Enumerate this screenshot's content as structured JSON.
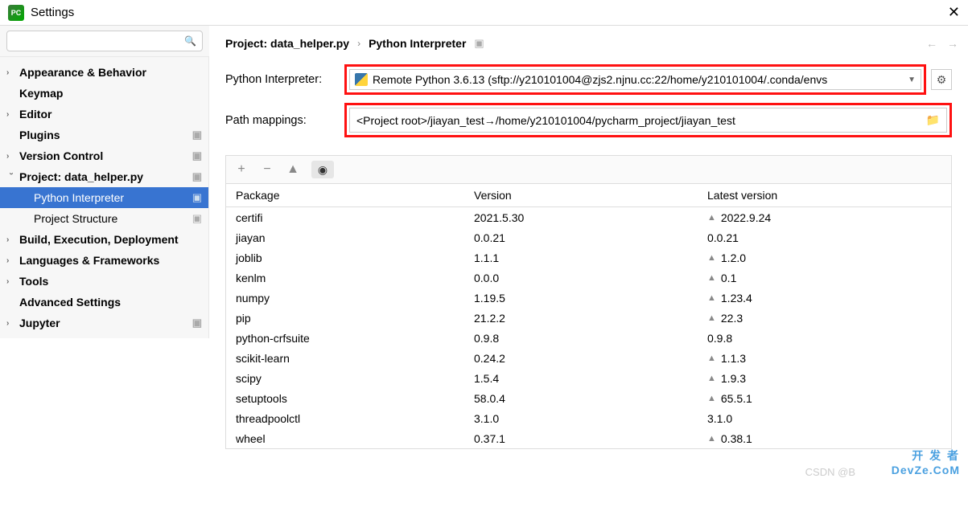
{
  "titlebar": {
    "title": "Settings"
  },
  "search": {
    "placeholder": ""
  },
  "sidebar": {
    "items": [
      {
        "label": "Appearance & Behavior"
      },
      {
        "label": "Keymap"
      },
      {
        "label": "Editor"
      },
      {
        "label": "Plugins"
      },
      {
        "label": "Version Control"
      },
      {
        "label": "Project: data_helper.py"
      },
      {
        "label": "Python Interpreter"
      },
      {
        "label": "Project Structure"
      },
      {
        "label": "Build, Execution, Deployment"
      },
      {
        "label": "Languages & Frameworks"
      },
      {
        "label": "Tools"
      },
      {
        "label": "Advanced Settings"
      },
      {
        "label": "Jupyter"
      }
    ]
  },
  "breadcrumb": {
    "project": "Project: data_helper.py",
    "page": "Python Interpreter"
  },
  "fields": {
    "interpreter_label": "Python Interpreter:",
    "interpreter_value": "Remote Python 3.6.13 (sftp://y210101004@zjs2.njnu.cc:22/home/y210101004/.conda/envs",
    "path_label": "Path mappings:",
    "path_value": "<Project root>/jiayan_test→/home/y210101004/pycharm_project/jiayan_test"
  },
  "table": {
    "headers": {
      "pkg": "Package",
      "ver": "Version",
      "lat": "Latest version"
    },
    "rows": [
      {
        "pkg": "certifi",
        "ver": "2021.5.30",
        "lat": "2022.9.24",
        "up": true
      },
      {
        "pkg": "jiayan",
        "ver": "0.0.21",
        "lat": "0.0.21",
        "up": false
      },
      {
        "pkg": "joblib",
        "ver": "1.1.1",
        "lat": "1.2.0",
        "up": true
      },
      {
        "pkg": "kenlm",
        "ver": "0.0.0",
        "lat": "0.1",
        "up": true
      },
      {
        "pkg": "numpy",
        "ver": "1.19.5",
        "lat": "1.23.4",
        "up": true
      },
      {
        "pkg": "pip",
        "ver": "21.2.2",
        "lat": "22.3",
        "up": true
      },
      {
        "pkg": "python-crfsuite",
        "ver": "0.9.8",
        "lat": "0.9.8",
        "up": false
      },
      {
        "pkg": "scikit-learn",
        "ver": "0.24.2",
        "lat": "1.1.3",
        "up": true
      },
      {
        "pkg": "scipy",
        "ver": "1.5.4",
        "lat": "1.9.3",
        "up": true
      },
      {
        "pkg": "setuptools",
        "ver": "58.0.4",
        "lat": "65.5.1",
        "up": true
      },
      {
        "pkg": "threadpoolctl",
        "ver": "3.1.0",
        "lat": "3.1.0",
        "up": false
      },
      {
        "pkg": "wheel",
        "ver": "0.37.1",
        "lat": "0.38.1",
        "up": true
      }
    ]
  },
  "watermark": {
    "line1": "开 发 者",
    "line2": "DevZe.CoM",
    "csdn": "CSDN @B"
  }
}
